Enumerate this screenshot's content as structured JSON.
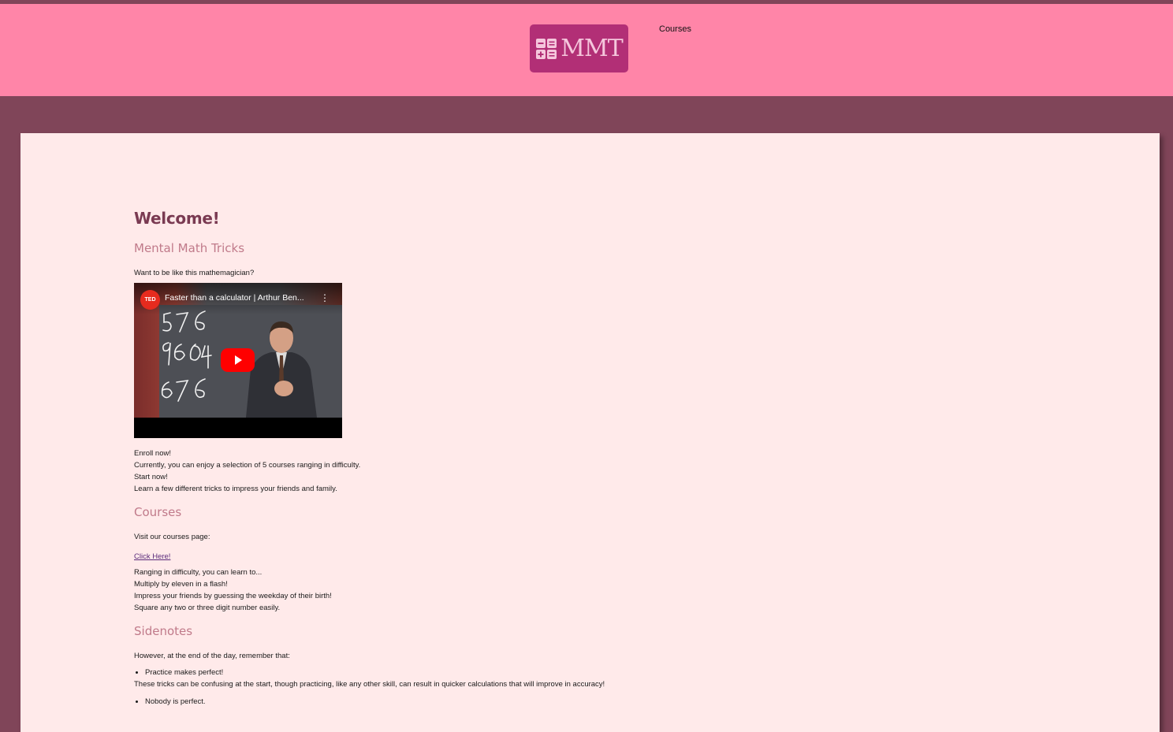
{
  "header": {
    "logo_text": "MMT",
    "nav_courses": "Courses"
  },
  "main": {
    "title": "Welcome!",
    "section1": {
      "heading": "Mental Math Tricks",
      "intro": "Want to be like this mathemagician?",
      "video": {
        "badge": "TED",
        "title": "Faster than a calculator | Arthur Ben..."
      },
      "lines": [
        "Enroll now!",
        "Currently, you can enjoy a selection of 5 courses ranging in difficulty.",
        "Start now!",
        "Learn a few different tricks to impress your friends and family."
      ]
    },
    "section2": {
      "heading": "Courses",
      "intro": "Visit our courses page:",
      "link": "Click Here!",
      "lines": [
        "Ranging in difficulty, you can learn to...",
        "Multiply by eleven in a flash!",
        "Impress your friends by guessing the weekday of their birth!",
        "Square any two or three digit number easily."
      ]
    },
    "section3": {
      "heading": "Sidenotes",
      "intro": "However, at the end of the day, remember that:",
      "bullet1": "Practice makes perfect!",
      "bullet1_text": "These tricks can be confusing at the start, though practicing, like any other skill, can result in quicker calculations that will improve in accuracy!",
      "bullet2": "Nobody is perfect."
    }
  }
}
